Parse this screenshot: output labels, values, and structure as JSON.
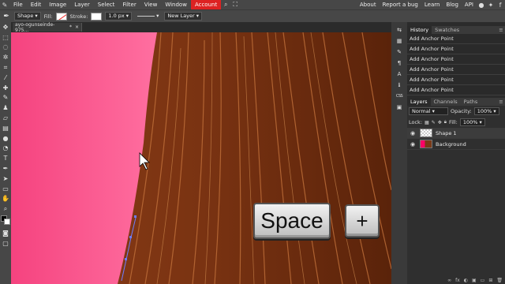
{
  "menubar": {
    "items": [
      {
        "label": "File"
      },
      {
        "label": "Edit"
      },
      {
        "label": "Image"
      },
      {
        "label": "Layer"
      },
      {
        "label": "Select"
      },
      {
        "label": "Filter"
      },
      {
        "label": "View"
      },
      {
        "label": "Window"
      }
    ],
    "account_label": "Account",
    "right_items": [
      {
        "label": "About"
      },
      {
        "label": "Report a bug"
      },
      {
        "label": "Learn"
      },
      {
        "label": "Blog"
      },
      {
        "label": "API"
      }
    ],
    "accent_color": "#dd2222"
  },
  "options": {
    "mode_label": "Shape",
    "fill_label": "Fill:",
    "stroke_label": "Stroke:",
    "stroke_width": "1.0 px",
    "new_layer_label": "New Layer"
  },
  "document": {
    "tab_title": "ayo-ogunseinde-975...",
    "tab_modified": "*",
    "tab_close": "×"
  },
  "overlay": {
    "key_space": "Space",
    "key_plus": "+"
  },
  "history": {
    "tabs": [
      {
        "label": "History"
      },
      {
        "label": "Swatches"
      }
    ],
    "items": [
      {
        "label": "Add Anchor Point"
      },
      {
        "label": "Add Anchor Point"
      },
      {
        "label": "Add Anchor Point"
      },
      {
        "label": "Add Anchor Point"
      },
      {
        "label": "Add Anchor Point"
      },
      {
        "label": "Add Anchor Point"
      }
    ]
  },
  "layers_panel": {
    "tabs": [
      {
        "label": "Layers"
      },
      {
        "label": "Channels"
      },
      {
        "label": "Paths"
      }
    ],
    "blend_mode": "Normal",
    "opacity_label": "Opacity:",
    "opacity_value": "100%",
    "lock_label": "Lock:",
    "fill_label": "Fill:",
    "fill_value": "100%",
    "layers": [
      {
        "name": "Shape 1",
        "visible": true
      },
      {
        "name": "Background",
        "visible": true
      }
    ]
  },
  "icons": {
    "tool_pen": "pen-icon",
    "mouse": "mouse-icon"
  }
}
